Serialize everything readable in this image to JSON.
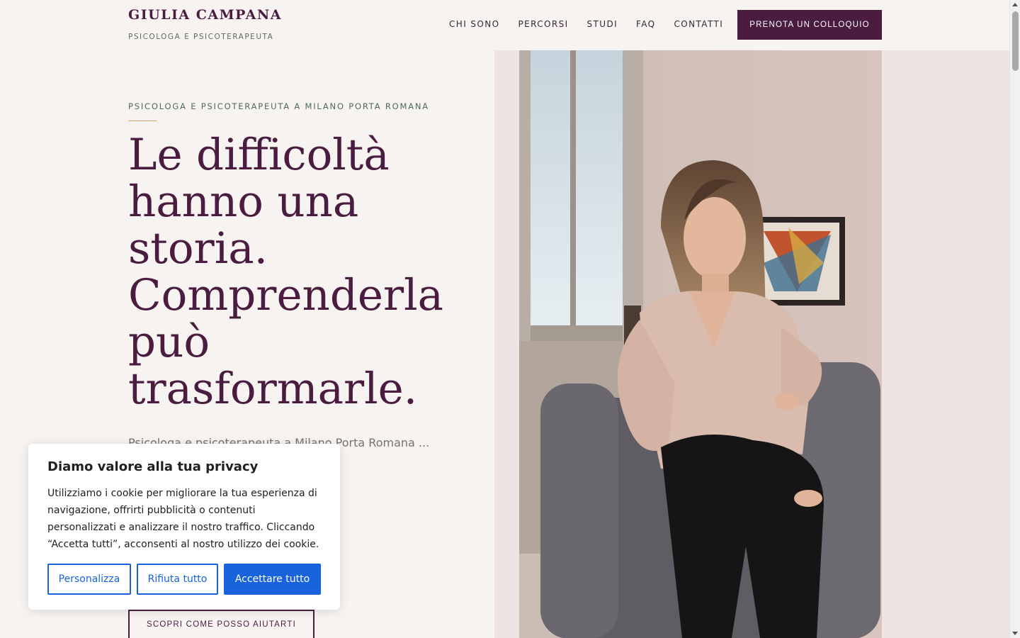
{
  "brand": {
    "name": "GIULIA CAMPANA",
    "tagline": "PSICOLOGA E PSICOTERAPEUTA"
  },
  "nav": {
    "items": [
      {
        "label": "CHI SONO"
      },
      {
        "label": "PERCORSI"
      },
      {
        "label": "STUDI"
      },
      {
        "label": "FAQ"
      },
      {
        "label": "CONTATTI"
      }
    ],
    "cta_label": "PRENOTA UN COLLOQUIO"
  },
  "hero": {
    "eyebrow": "PSICOLOGA E PSICOTERAPEUTA A MILANO PORTA ROMANA",
    "headline": "Le difficoltà hanno una storia. Comprenderla può trasformarle.",
    "body": "Psicologa e psicoterapeuta a Milano Porta Romana ... ignificato alla ... lità di",
    "secondary_cta": "SCOPRI COME POSSO AIUTARTI",
    "image_alt": "Giulia Campana seduta in poltrona nello studio"
  },
  "cookie": {
    "title": "Diamo valore alla tua privacy",
    "text": "Utilizziamo i cookie per migliorare la tua esperienza di navigazione, offrirti pubblicità o contenuti personalizzati e analizzare il nostro traffico. Cliccando “Accetta tutti”, acconsenti al nostro utilizzo dei cookie.",
    "customize": "Personalizza",
    "reject": "Rifiuta tutto",
    "accept": "Accettare tutto"
  },
  "colors": {
    "brand": "#4a1c3f",
    "background": "#f6f3f0",
    "hero_panel": "#f0e3e4",
    "cookie_button": "#1863dc",
    "accent_rule": "#c8a46a"
  }
}
